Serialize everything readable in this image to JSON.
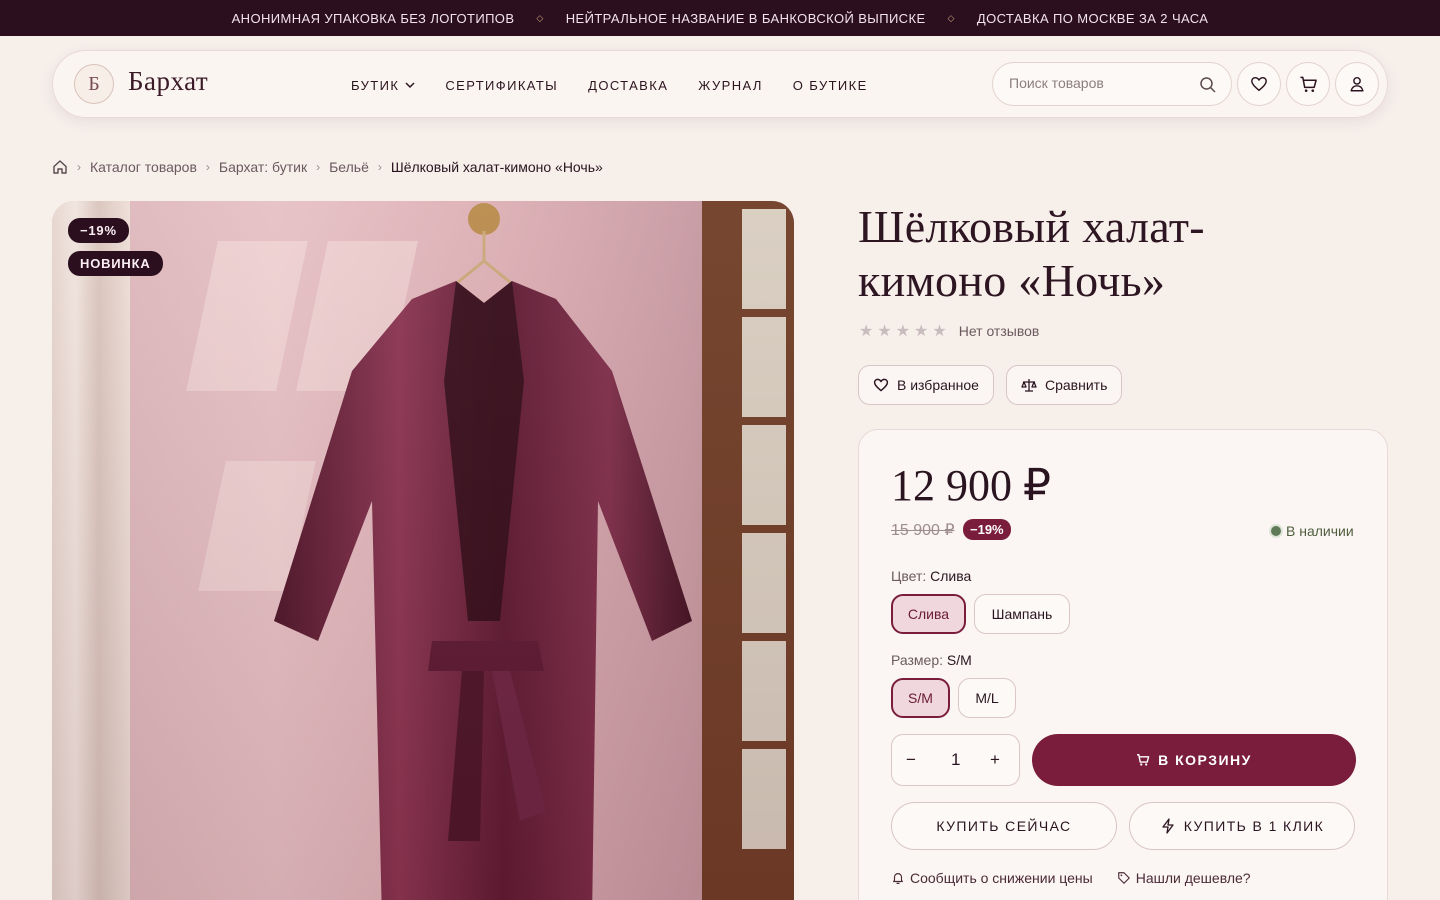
{
  "topbar": {
    "items": [
      "АНОНИМНАЯ УПАКОВКА БЕЗ ЛОГОТИПОВ",
      "НЕЙТРАЛЬНОЕ НАЗВАНИЕ В БАНКОВСКОЙ ВЫПИСКЕ",
      "ДОСТАВКА ПО МОСКВЕ ЗА 2 ЧАСА"
    ]
  },
  "header": {
    "logo_letter": "Б",
    "logo_text": "Бархат",
    "nav": [
      "БУТИК",
      "СЕРТИФИКАТЫ",
      "ДОСТАВКА",
      "ЖУРНАЛ",
      "О БУТИКЕ"
    ],
    "search_placeholder": "Поиск товаров"
  },
  "breadcrumb": [
    "Каталог товаров",
    "Бархат: бутик",
    "Бельё",
    "Шёлковый халат-кимоно «Ночь»"
  ],
  "product": {
    "badges": [
      "−19%",
      "НОВИНКА"
    ],
    "title_line1": "Шёлковый халат-",
    "title_line2": "кимоно «Ночь»",
    "rating_text": "Нет отзывов",
    "rating_stars": 0,
    "favorite_label": "В избранное",
    "compare_label": "Сравнить",
    "price": "12 900 ₽",
    "old_price": "15 900 ₽",
    "discount": "−19%",
    "stock": "В наличии",
    "color_label": "Цвет:",
    "color_value": "Слива",
    "colors": [
      "Слива",
      "Шампань"
    ],
    "size_label": "Размер:",
    "size_value": "S/M",
    "sizes": [
      "S/M",
      "M/L"
    ],
    "qty_minus": "−",
    "quantity": "1",
    "qty_plus": "+",
    "cart_label": "В КОРЗИНУ",
    "buy_now": "КУПИТЬ СЕЙЧАС",
    "buy_one_click": "КУПИТЬ В 1 КЛИК",
    "price_alert": "Сообщить о снижении цены",
    "found_cheaper": "Нашли дешевле?"
  },
  "colors": {
    "brand_dark": "#2b0f1f",
    "accent": "#7a1d3d",
    "stock_green": "#5f7a57"
  }
}
